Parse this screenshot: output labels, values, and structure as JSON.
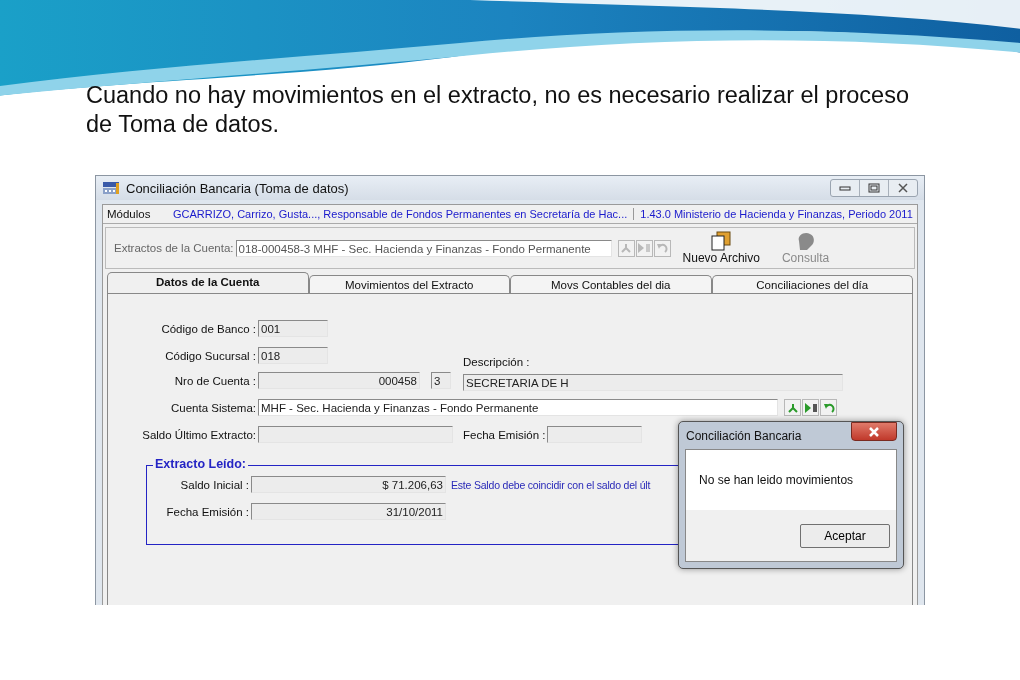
{
  "caption": "Cuando no hay movimientos en el extracto, no es necesario realizar el proceso de Toma de datos.",
  "window": {
    "title": "Conciliación Bancaria (Toma de datos)"
  },
  "modules_bar": {
    "label": "Módulos",
    "user": "GCARRIZO, Carrizo, Gusta..., Responsable de Fondos Permanentes en Secretaría de Hac...",
    "version": "1.43.0 Ministerio de Hacienda y Finanzas, Periodo 2011"
  },
  "toolbar": {
    "label": "Extractos de la Cuenta:",
    "value": "018-000458-3 MHF - Sec. Hacienda y Finanzas - Fondo Permanente",
    "nav_disabled": true,
    "buttons": [
      {
        "kind": "new-file",
        "label": "Nuevo Archivo",
        "disabled": false
      },
      {
        "kind": "query",
        "label": "Consulta",
        "disabled": true
      }
    ]
  },
  "tabs": [
    {
      "label": "Datos de la Cuenta",
      "selected": true
    },
    {
      "label": "Movimientos del Extracto",
      "selected": false
    },
    {
      "label": "Movs Contables del dia",
      "selected": false
    },
    {
      "label": "Conciliaciones del día",
      "selected": false
    }
  ],
  "form": {
    "bank_code": {
      "label": "Código de Banco :",
      "value": "001"
    },
    "branch_code": {
      "label": "Código Sucursal :",
      "value": "018"
    },
    "account_number": {
      "label": "Nro de Cuenta :",
      "value": "000458",
      "check_digit": "3"
    },
    "description": {
      "label": "Descripción :",
      "value": "SECRETARIA DE H"
    },
    "system_account": {
      "label": "Cuenta Sistema:",
      "value": "MHF - Sec. Hacienda y Finanzas - Fondo Permanente",
      "nav_disabled": false
    },
    "last_statement_balance": {
      "label": "Saldo Último Extracto:"
    },
    "issue_date": {
      "label": "Fecha Emisión :"
    }
  },
  "statement_read": {
    "title": "Extracto Leído:",
    "initial_balance": {
      "label": "Saldo Inicial :",
      "value": "$ 71.206,63",
      "note": "Este Saldo debe coincidir con el saldo del últ"
    },
    "issue_date": {
      "label": "Fecha Emisión :",
      "value": "31/10/2011"
    }
  },
  "dialog": {
    "title": "Conciliación Bancaria",
    "message": "No se han leido movimientos",
    "button": "Aceptar"
  }
}
